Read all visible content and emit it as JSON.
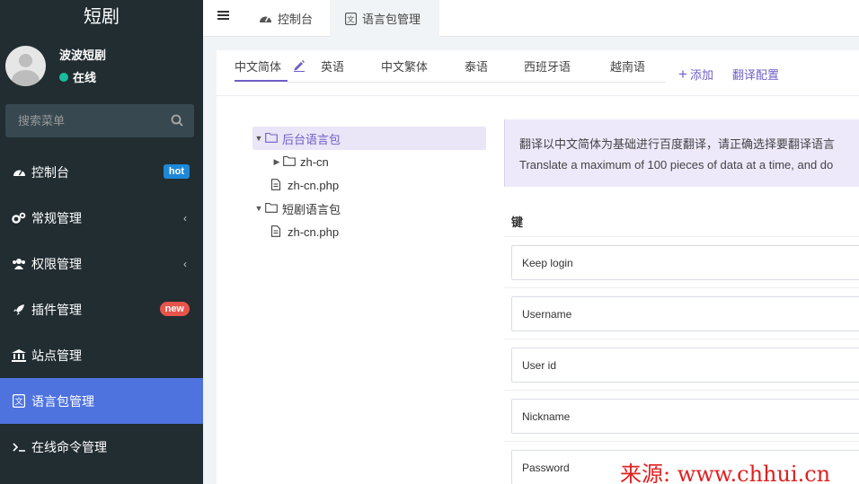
{
  "sidebar": {
    "brand": "短剧",
    "user": {
      "name": "波波短剧",
      "status": "在线"
    },
    "search": {
      "placeholder": "搜索菜单"
    },
    "items": [
      {
        "label": "控制台",
        "badge": "hot"
      },
      {
        "label": "常规管理"
      },
      {
        "label": "权限管理"
      },
      {
        "label": "插件管理",
        "badge": "new"
      },
      {
        "label": "站点管理"
      },
      {
        "label": "语言包管理"
      },
      {
        "label": "在线命令管理"
      }
    ]
  },
  "topbar": {
    "tabs": [
      {
        "label": "控制台"
      },
      {
        "label": "语言包管理"
      }
    ]
  },
  "lang_tabs": {
    "items": [
      "中文简体",
      "英语",
      "中文繁体",
      "泰语",
      "西班牙语",
      "越南语"
    ],
    "add_label": "添加",
    "config_label": "翻译配置"
  },
  "tree": {
    "nodes": [
      {
        "label": "后台语言包"
      },
      {
        "label": "zh-cn"
      },
      {
        "label": "zh-cn.php"
      },
      {
        "label": "短剧语言包"
      },
      {
        "label": "zh-cn.php"
      }
    ]
  },
  "notice": {
    "line1": "翻译以中文简体为基础进行百度翻译，请正确选择要翻译语言",
    "line2": "Translate a maximum of 100 pieces of data at a time, and do"
  },
  "keys": {
    "header": "键",
    "rows": [
      "Keep login",
      "Username",
      "User id",
      "Nickname",
      "Password"
    ]
  },
  "watermark": "来源: www.chhui.cn",
  "colors": {
    "accent": "#6f5fc5",
    "sidebar": "#222d32",
    "active_menu": "#4e73df"
  }
}
